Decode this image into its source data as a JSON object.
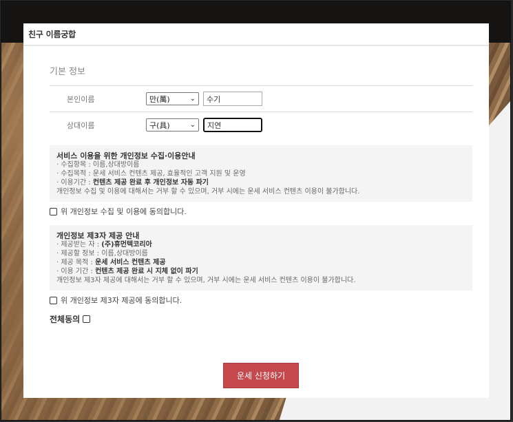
{
  "modal": {
    "title": "친구 이름궁합"
  },
  "basic_info": {
    "title": "기본 정보",
    "self": {
      "label": "본인이름",
      "surname_selected": "만(萬)",
      "given_name": "수기"
    },
    "partner": {
      "label": "상대이름",
      "surname_selected": "구(具)",
      "given_name": "지연"
    }
  },
  "privacy_notice": {
    "title": "서비스 이용을 위한 개인정보 수집·이용안내",
    "line1": "· 수집항목 : 이름,상대방이름",
    "line2": "· 수집목적 : 운세 서비스 컨텐츠 제공, 효율적인 고객 지원 및 운영",
    "line3_prefix": "· 이용기간 : ",
    "line3_bold": "컨텐츠 제공 완료 후 개인정보 자동 파기",
    "line4": "개인정보 수집 및 이용에 대해서는 거부 할 수 있으며, 거부 시에는 운세 서비스 컨텐츠 이용이 불가합니다.",
    "consent_label": "위 개인정보 수집 및 이용에 동의합니다."
  },
  "third_party_notice": {
    "title": "개인정보 제3자 제공 안내",
    "line1_prefix": "· 제공받는 자 : ",
    "line1_bold": "(주)휴먼텍코리아",
    "line2": "· 제공할 정보 : 이름,상대방이름",
    "line3_prefix": "· 제공 목적 : ",
    "line3_bold": "운세 서비스 컨텐츠 제공",
    "line4_prefix": "· 이용 기간 : ",
    "line4_bold": "컨텐츠 제공 완료 시 지체 없이 파기",
    "line5": "개인정보 제3자 제공에 대해서는 거부 할 수 있으며, 거부 시에는 운세 서비스 컨텐츠 이용이 불가합니다.",
    "consent_label": "위 개인정보 제3자 제공에 동의합니다."
  },
  "all_agree_label": "전체동의",
  "submit_label": "운세 신청하기"
}
